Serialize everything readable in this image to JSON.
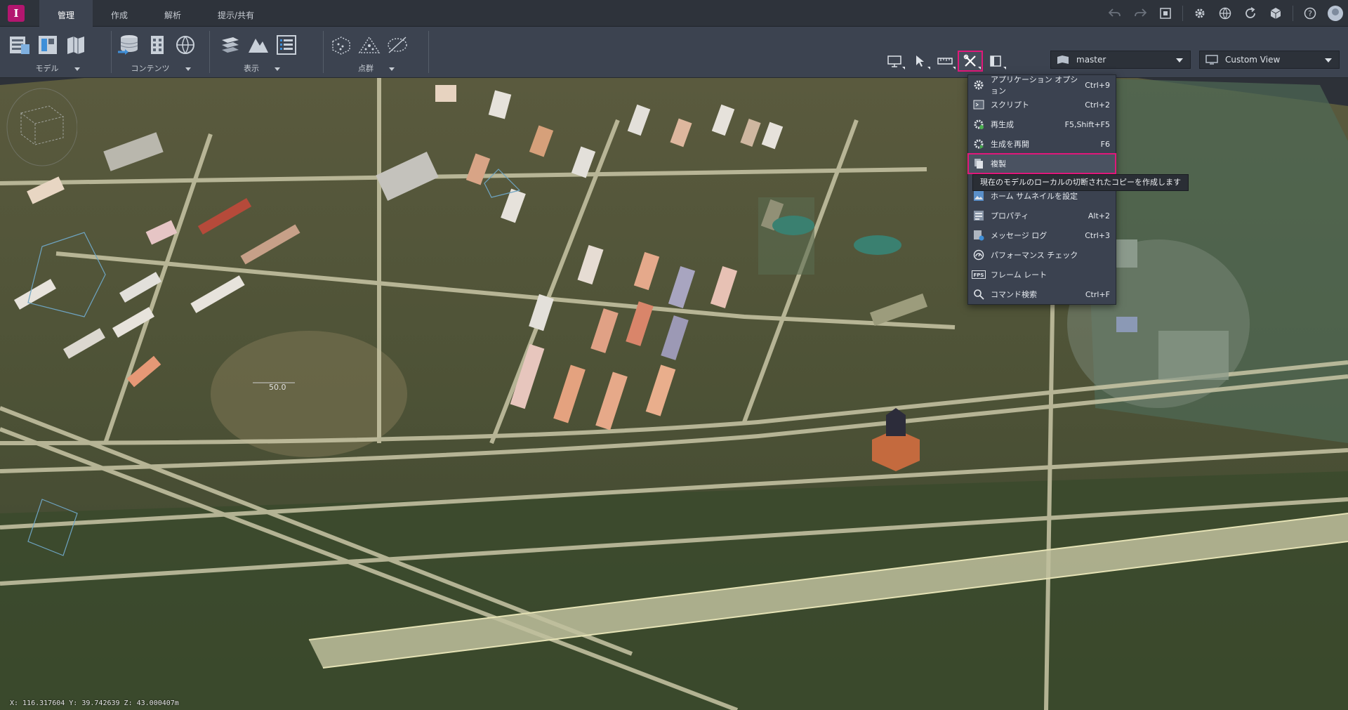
{
  "app": {
    "logo_letter": "I"
  },
  "tabs": [
    {
      "label": "管理",
      "active": true
    },
    {
      "label": "作成",
      "active": false
    },
    {
      "label": "解析",
      "active": false
    },
    {
      "label": "提示/共有",
      "active": false
    }
  ],
  "top_icons": [
    "undo-icon",
    "redo-icon",
    "screenshot-icon",
    "settings-icon",
    "globe-icon",
    "refresh-icon",
    "cube-icon",
    "help-icon",
    "user-avatar"
  ],
  "ribbon": {
    "groups": [
      {
        "label": "モデル"
      },
      {
        "label": "コンテンツ"
      },
      {
        "label": "表示"
      },
      {
        "label": "点群"
      }
    ]
  },
  "toolbar": {
    "proposal_value": "master",
    "view_value": "Custom View"
  },
  "menu": {
    "items": [
      {
        "label": "アプリケーション オプション",
        "shortcut": "Ctrl+9",
        "icon": "gear-icon"
      },
      {
        "label": "スクリプト",
        "shortcut": "Ctrl+2",
        "icon": "script-icon"
      },
      {
        "label": "再生成",
        "shortcut": "F5,Shift+F5",
        "icon": "regenerate-icon"
      },
      {
        "label": "生成を再開",
        "shortcut": "F6",
        "icon": "resume-icon"
      },
      {
        "label": "複製",
        "shortcut": "",
        "icon": "duplicate-icon",
        "active": true
      },
      {
        "label": "ホーム サムネイルを設定",
        "shortcut": "",
        "icon": "thumbnail-icon"
      },
      {
        "label": "プロパティ",
        "shortcut": "Alt+2",
        "icon": "properties-icon"
      },
      {
        "label": "メッセージ ログ",
        "shortcut": "Ctrl+3",
        "icon": "message-log-icon"
      },
      {
        "label": "パフォーマンス チェック",
        "shortcut": "",
        "icon": "performance-icon"
      },
      {
        "label": "フレーム レート",
        "shortcut": "",
        "icon": "fps-icon"
      },
      {
        "label": "コマンド検索",
        "shortcut": "Ctrl+F",
        "icon": "search-icon"
      }
    ],
    "tooltip": "現在のモデルのローカルの切断されたコピーを作成します"
  },
  "viewport": {
    "coordinates": "X: 116.317604 Y: 39.742639 Z: 43.000407m",
    "elevation_label": "50.0"
  },
  "colors": {
    "accent": "#e0187a",
    "logo": "#b3166f"
  }
}
